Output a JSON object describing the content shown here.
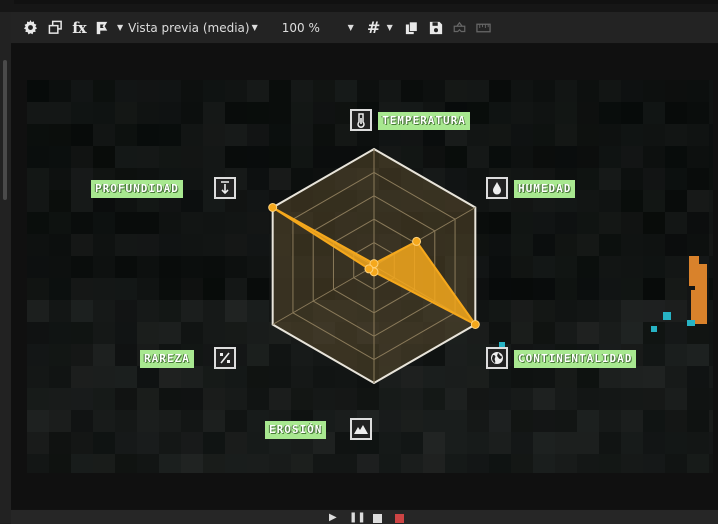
{
  "toolbar": {
    "view_mode": "Vista previa (media)",
    "zoom": "100 %"
  },
  "radar": {
    "axes": [
      {
        "label": "TEMPERATURA",
        "icon": "thermometer-icon",
        "value": 0.02
      },
      {
        "label": "HUMEDAD",
        "icon": "water-drop-icon",
        "value": 0.42
      },
      {
        "label": "CONTINENTALIDAD",
        "icon": "globe-icon",
        "value": 1.0
      },
      {
        "label": "EROSIÓN",
        "icon": "mountain-icon",
        "value": 0.05
      },
      {
        "label": "RAREZA",
        "icon": "percent-icon",
        "value": 0.05
      },
      {
        "label": "PROFUNDIDAD",
        "icon": "depth-arrow-icon",
        "value": 1.0
      }
    ],
    "rings": 5,
    "fill_color": "#f5a81c",
    "label_bg": "#a8e890"
  }
}
